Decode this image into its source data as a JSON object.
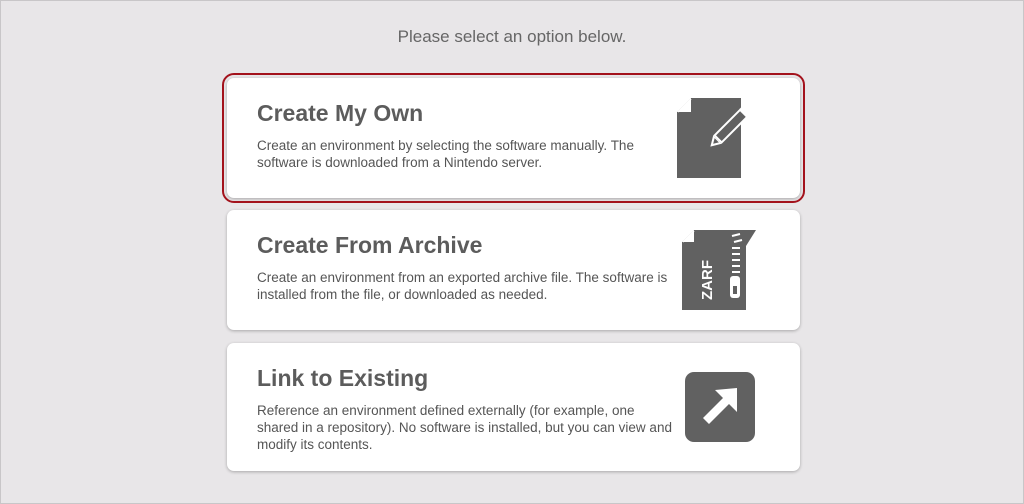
{
  "prompt": "Please select an option below.",
  "options": [
    {
      "title": "Create My Own",
      "description": "Create an environment by selecting the software manually. The software is downloaded from a Nintendo server.",
      "icon": "document-edit-icon",
      "selected": true
    },
    {
      "title": "Create From Archive",
      "description": "Create an environment from an exported archive file. The software is installed from the file, or downloaded as needed.",
      "icon": "zip-archive-icon",
      "icon_text": "ZARF",
      "selected": false
    },
    {
      "title": "Link to Existing",
      "description": "Reference an environment defined externally (for example, one shared in a repository). No software is installed, but you can view and modify its contents.",
      "icon": "external-link-icon",
      "selected": false
    }
  ],
  "colors": {
    "background": "#e8e6e8",
    "card": "#ffffff",
    "icon": "#616161",
    "selected_border": "#a3121c",
    "title": "#5c5c5c",
    "text": "#555555"
  }
}
